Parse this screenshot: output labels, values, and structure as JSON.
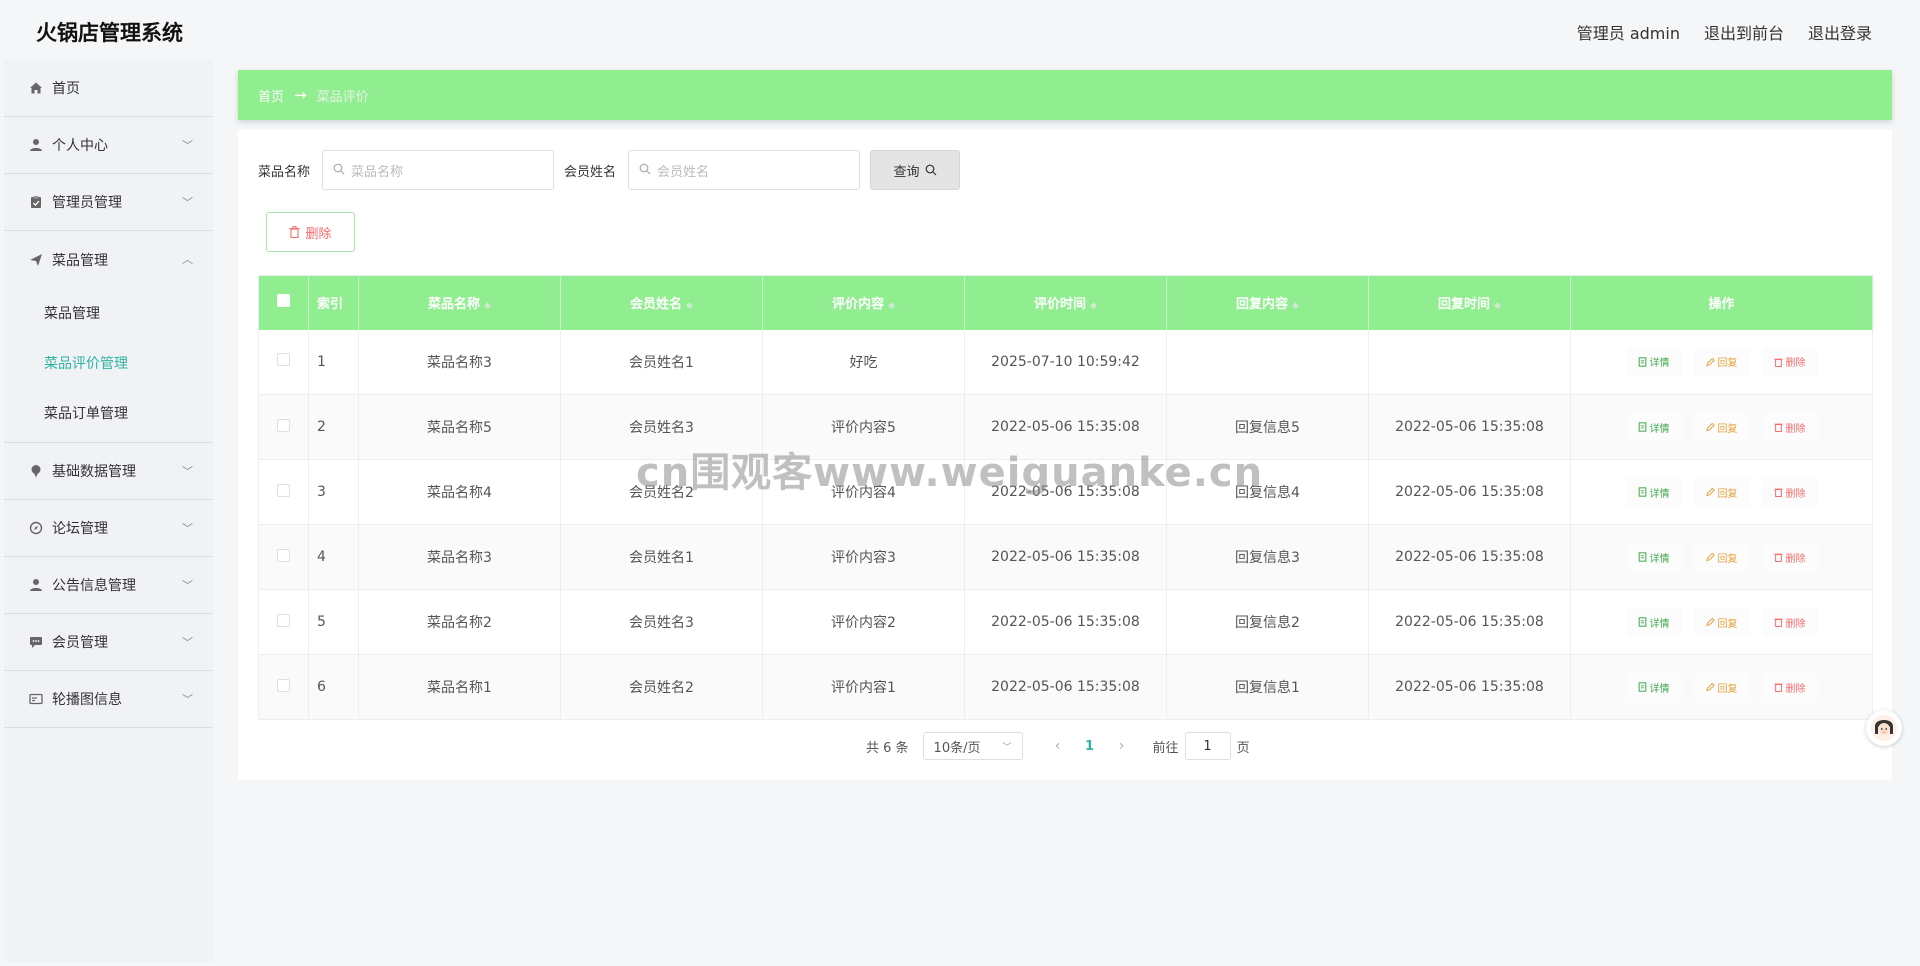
{
  "header": {
    "title": "火锅店管理系统",
    "admin_label": "管理员 admin",
    "exit_front": "退出到前台",
    "logout": "退出登录"
  },
  "sidebar": {
    "items": [
      {
        "label": "首页",
        "icon": "home-icon"
      },
      {
        "label": "个人中心",
        "icon": "user-icon"
      },
      {
        "label": "管理员管理",
        "icon": "clipboard-icon"
      },
      {
        "label": "菜品管理",
        "icon": "send-icon"
      },
      {
        "label": "基础数据管理",
        "icon": "pin-icon"
      },
      {
        "label": "论坛管理",
        "icon": "compass-icon"
      },
      {
        "label": "公告信息管理",
        "icon": "user-icon"
      },
      {
        "label": "会员管理",
        "icon": "chat-icon"
      },
      {
        "label": "轮播图信息",
        "icon": "card-icon"
      }
    ],
    "submenu": [
      "菜品管理",
      "菜品评价管理",
      "菜品订单管理"
    ]
  },
  "breadcrumb": {
    "home": "首页",
    "arrow": "→",
    "current": "菜品评价"
  },
  "search": {
    "dish_label": "菜品名称",
    "dish_placeholder": "菜品名称",
    "member_label": "会员姓名",
    "member_placeholder": "会员姓名",
    "query_button": "查询"
  },
  "toolbar": {
    "delete_label": "删除"
  },
  "table": {
    "headers": [
      "索引",
      "菜品名称",
      "会员姓名",
      "评价内容",
      "评价时间",
      "回复内容",
      "回复时间",
      "操作"
    ],
    "rows": [
      {
        "index": "1",
        "dish": "菜品名称3",
        "member": "会员姓名1",
        "content": "好吃",
        "time": "2025-07-10 10:59:42",
        "reply": "",
        "reply_time": ""
      },
      {
        "index": "2",
        "dish": "菜品名称5",
        "member": "会员姓名3",
        "content": "评价内容5",
        "time": "2022-05-06 15:35:08",
        "reply": "回复信息5",
        "reply_time": "2022-05-06 15:35:08"
      },
      {
        "index": "3",
        "dish": "菜品名称4",
        "member": "会员姓名2",
        "content": "评价内容4",
        "time": "2022-05-06 15:35:08",
        "reply": "回复信息4",
        "reply_time": "2022-05-06 15:35:08"
      },
      {
        "index": "4",
        "dish": "菜品名称3",
        "member": "会员姓名1",
        "content": "评价内容3",
        "time": "2022-05-06 15:35:08",
        "reply": "回复信息3",
        "reply_time": "2022-05-06 15:35:08"
      },
      {
        "index": "5",
        "dish": "菜品名称2",
        "member": "会员姓名3",
        "content": "评价内容2",
        "time": "2022-05-06 15:35:08",
        "reply": "回复信息2",
        "reply_time": "2022-05-06 15:35:08"
      },
      {
        "index": "6",
        "dish": "菜品名称1",
        "member": "会员姓名2",
        "content": "评价内容1",
        "time": "2022-05-06 15:35:08",
        "reply": "回复信息1",
        "reply_time": "2022-05-06 15:35:08"
      }
    ],
    "op_labels": {
      "detail": "详情",
      "reply": "回复",
      "delete": "删除"
    }
  },
  "pagination": {
    "total": "共 6 条",
    "page_size": "10条/页",
    "current_page": "1",
    "goto_label": "前往",
    "goto_value": "1",
    "page_unit": "页"
  },
  "watermark": "cn围观客www.weiguanke.cn",
  "colors": {
    "accent": "#90ee90",
    "active_text": "#2fb3a4",
    "danger": "#f56c6c",
    "warning": "#e6a23c",
    "success": "#3ea84b"
  }
}
